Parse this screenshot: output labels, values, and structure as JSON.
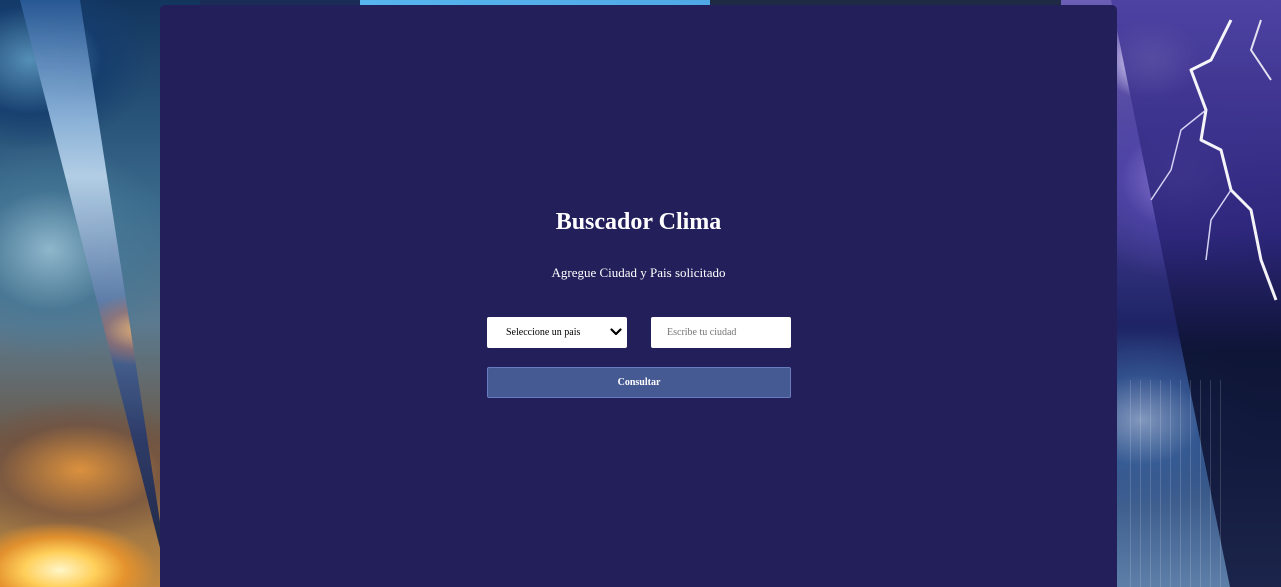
{
  "form": {
    "title": "Buscador Clima",
    "subtitle": "Agregue Ciudad y Pais solicitado",
    "country_select": {
      "selected": "Seleccione un pais"
    },
    "city_input": {
      "value": "",
      "placeholder": "Escribe tu ciudad"
    },
    "submit_label": "Consultar"
  },
  "colors": {
    "card_background": "#221f5a",
    "button_background": "#455a93",
    "input_background": "#ffffff"
  },
  "icons": {
    "select_arrow": "chevron-down-icon"
  }
}
